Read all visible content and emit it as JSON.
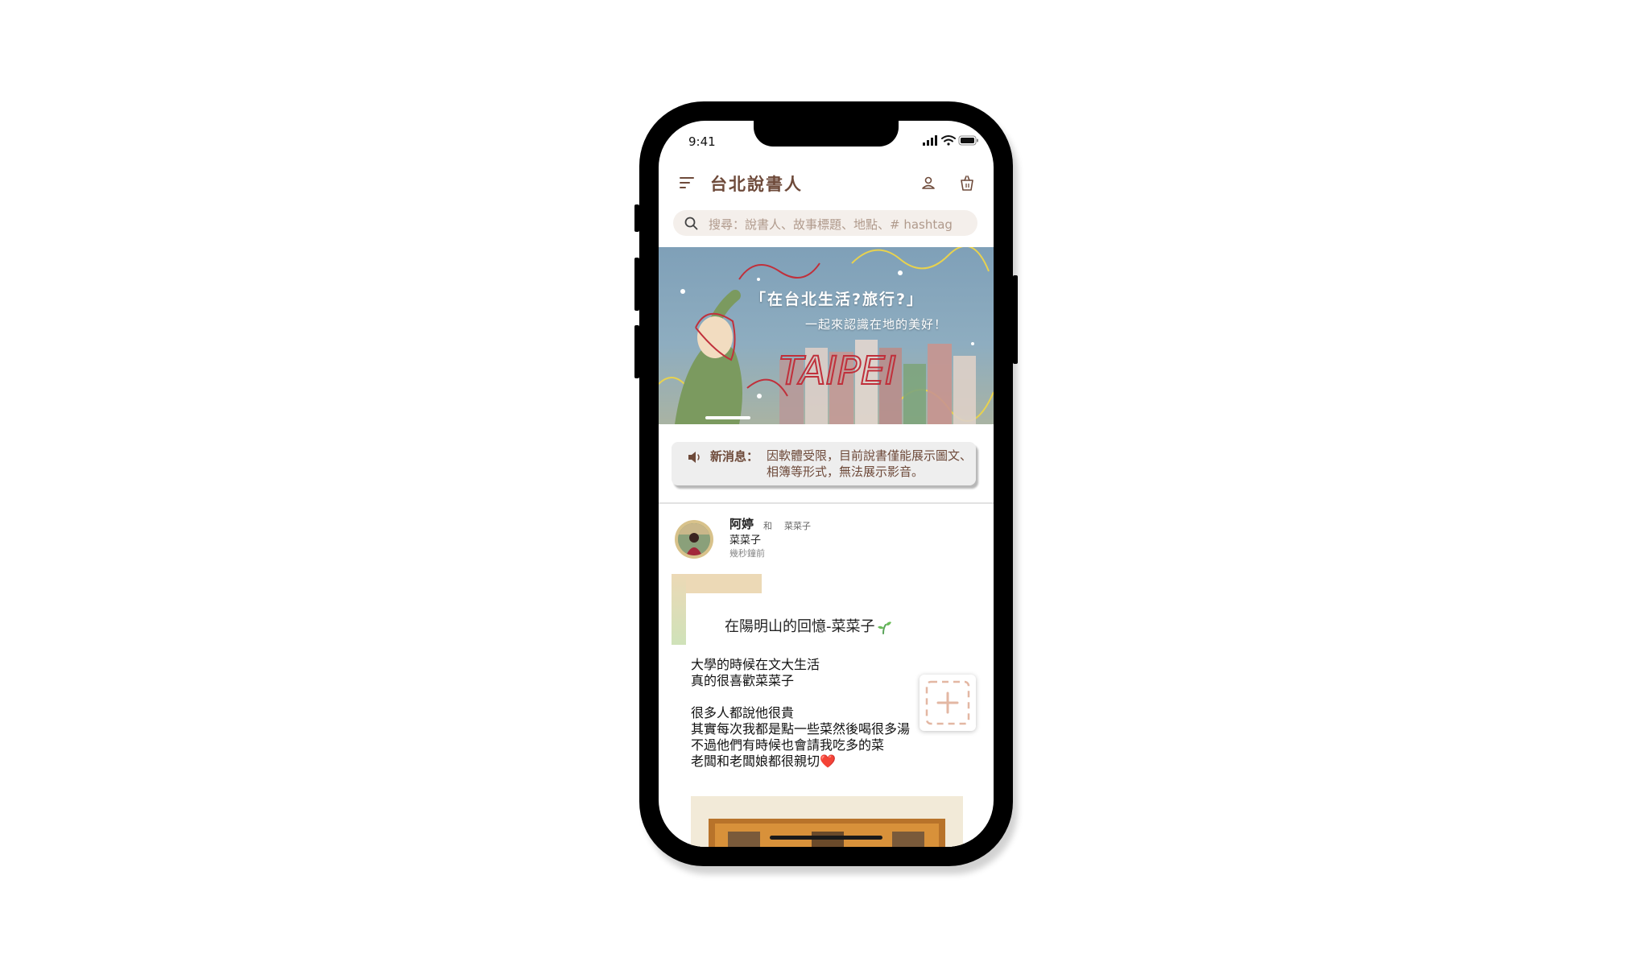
{
  "status_bar": {
    "time": "9:41"
  },
  "app_bar": {
    "title": "台北說書人"
  },
  "search": {
    "placeholder": "搜尋：說書人、故事標題、地點、# hashtag"
  },
  "banner": {
    "line1": "「在台北生活?旅行?」",
    "line2": "一起來認識在地的美好！",
    "art_text": "TAIPEI"
  },
  "news": {
    "label": "新消息：",
    "text": "因軟體受限，目前說書僅能展示圖文、相簿等形式，無法展示影音。"
  },
  "post": {
    "author": "阿婷",
    "and_label": "和",
    "mention": "菜菜子",
    "place": "菜菜子",
    "time": "幾秒鐘前",
    "title": "在陽明山的回憶-菜菜子",
    "body": "大學的時候在文大生活\n真的很喜歡菜菜子\n\n很多人都說他很貴\n其實每次我都是點一些菜然後喝很多湯\n不過他們有時候也會請我吃多的菜\n老闆和老闆娘都很親切❤️"
  },
  "colors": {
    "brand_brown": "#6e4a3a",
    "search_bg": "#f4efeb",
    "news_bg": "#eeeeee",
    "add_dash": "#e3b7a3"
  },
  "icons": [
    "menu-icon",
    "user-icon",
    "basket-icon",
    "search-icon",
    "speaker-icon",
    "sprout-icon",
    "add-icon",
    "signal-icon",
    "wifi-icon",
    "battery-icon"
  ]
}
